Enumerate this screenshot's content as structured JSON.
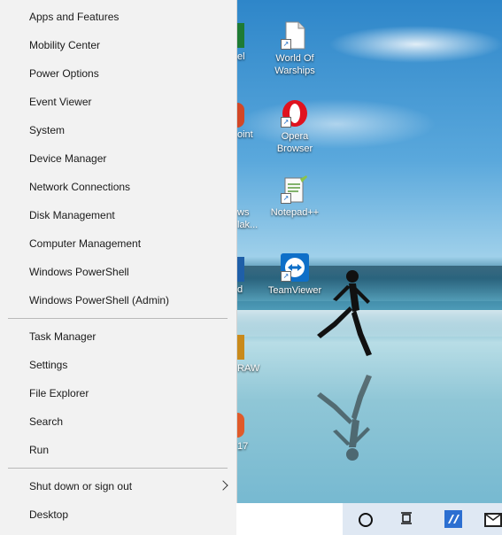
{
  "menu": {
    "items": [
      {
        "label": "Apps and Features"
      },
      {
        "label": "Mobility Center"
      },
      {
        "label": "Power Options"
      },
      {
        "label": "Event Viewer"
      },
      {
        "label": "System"
      },
      {
        "label": "Device Manager"
      },
      {
        "label": "Network Connections"
      },
      {
        "label": "Disk Management"
      },
      {
        "label": "Computer Management"
      },
      {
        "label": "Windows PowerShell"
      },
      {
        "label": "Windows PowerShell (Admin)"
      },
      {
        "label": "Task Manager"
      },
      {
        "label": "Settings"
      },
      {
        "label": "File Explorer"
      },
      {
        "label": "Search"
      },
      {
        "label": "Run"
      },
      {
        "label": "Shut down or sign out"
      },
      {
        "label": "Desktop"
      }
    ]
  },
  "desktop": {
    "icons": [
      {
        "label": "World Of Warships",
        "icon": "document-icon"
      },
      {
        "label": "Opera Browser",
        "icon": "opera-icon"
      },
      {
        "label": "Notepad++",
        "icon": "notepadpp-icon"
      },
      {
        "label": "TeamViewer",
        "icon": "teamviewer-icon"
      }
    ],
    "partial_labels": [
      "el",
      "oint",
      "ws",
      "lak...",
      "d",
      "RAW",
      "17"
    ]
  },
  "colors": {
    "menu_bg": "#f2f2f2",
    "separator": "#b9b9b9",
    "taskbar": "#dfe8f3",
    "opera_red": "#e0121e",
    "teamviewer_blue": "#0e6fc8"
  }
}
